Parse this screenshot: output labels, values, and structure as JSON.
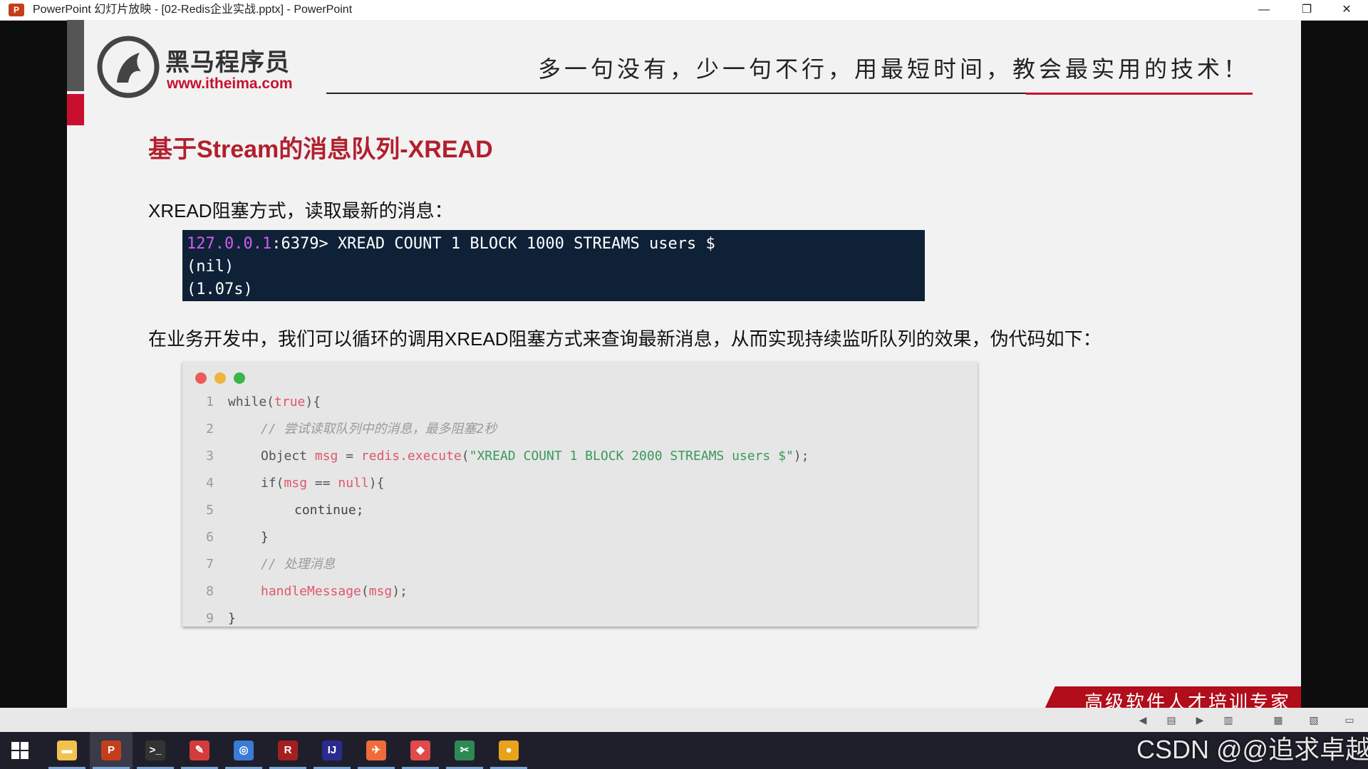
{
  "window": {
    "title": "PowerPoint 幻灯片放映 - [02-Redis企业实战.pptx] - PowerPoint",
    "app_icon": "P",
    "minimize": "—",
    "maximize": "❐",
    "close": "✕"
  },
  "slide": {
    "logo": {
      "cn": "黑马程序员",
      "url": "www.itheima.com"
    },
    "motto": "多一句没有，少一句不行，用最短时间，教会最实用的技术！",
    "title": "基于Stream的消息队列-XREAD",
    "subtitle": "XREAD阻塞方式，读取最新的消息：",
    "terminal": {
      "ip": "127.0.0.1",
      "command": ":6379> XREAD COUNT 1 BLOCK 1000 STREAMS users $",
      "line2": "(nil)",
      "line3": "(1.07s)"
    },
    "paragraph": "在业务开发中，我们可以循环的调用XREAD阻塞方式来查询最新消息，从而实现持续监听队列的效果，伪代码如下：",
    "code": {
      "line_numbers": [
        "1",
        "2",
        "3",
        "4",
        "5",
        "6",
        "7",
        "8",
        "9"
      ],
      "l1_kw": "while(",
      "l1_v": "true",
      "l1_end": "){",
      "l2": "// 尝试读取队列中的消息，最多阻塞2秒",
      "l3_a": "Object ",
      "l3_v": "msg",
      "l3_b": " = ",
      "l3_obj": "redis",
      "l3_m": ".execute",
      "l3_p1": "(",
      "l3_str": "\"XREAD COUNT 1 BLOCK 2000 STREAMS users $\"",
      "l3_p2": ");",
      "l4_a": "if(",
      "l4_v": "msg",
      "l4_b": " == ",
      "l4_n": "null",
      "l4_c": "){",
      "l5": "continue;",
      "l6": "}",
      "l7": "// 处理消息",
      "l8_f": "handleMessage",
      "l8_p1": "(",
      "l8_v": "msg",
      "l8_p2": ");",
      "l9": "}"
    },
    "banner": "高级软件人才培训专家"
  },
  "taskbar": {
    "apps": [
      {
        "name": "file-explorer",
        "glyph": "▬",
        "color": "#f2c14e"
      },
      {
        "name": "powerpoint",
        "glyph": "P",
        "color": "#c43e1c"
      },
      {
        "name": "terminal",
        "glyph": ">_",
        "color": "#333333"
      },
      {
        "name": "pen-app",
        "glyph": "✎",
        "color": "#d43c3c"
      },
      {
        "name": "browser-app",
        "glyph": "◎",
        "color": "#3a7bd5"
      },
      {
        "name": "redis-app",
        "glyph": "R",
        "color": "#a32020"
      },
      {
        "name": "intellij",
        "glyph": "IJ",
        "color": "#2b2b8f"
      },
      {
        "name": "postman",
        "glyph": "✈",
        "color": "#ef6c3a"
      },
      {
        "name": "eraser-app",
        "glyph": "◆",
        "color": "#e04a4a"
      },
      {
        "name": "snipping-app",
        "glyph": "✂",
        "color": "#2d8a55"
      },
      {
        "name": "chrome",
        "glyph": "●",
        "color": "#e8a21c"
      }
    ]
  },
  "watermark": "CSDN @@追求卓越",
  "colors": {
    "accent_red": "#c8102e",
    "terminal_bg": "#0f2137",
    "ip_purple": "#d05cf0"
  }
}
